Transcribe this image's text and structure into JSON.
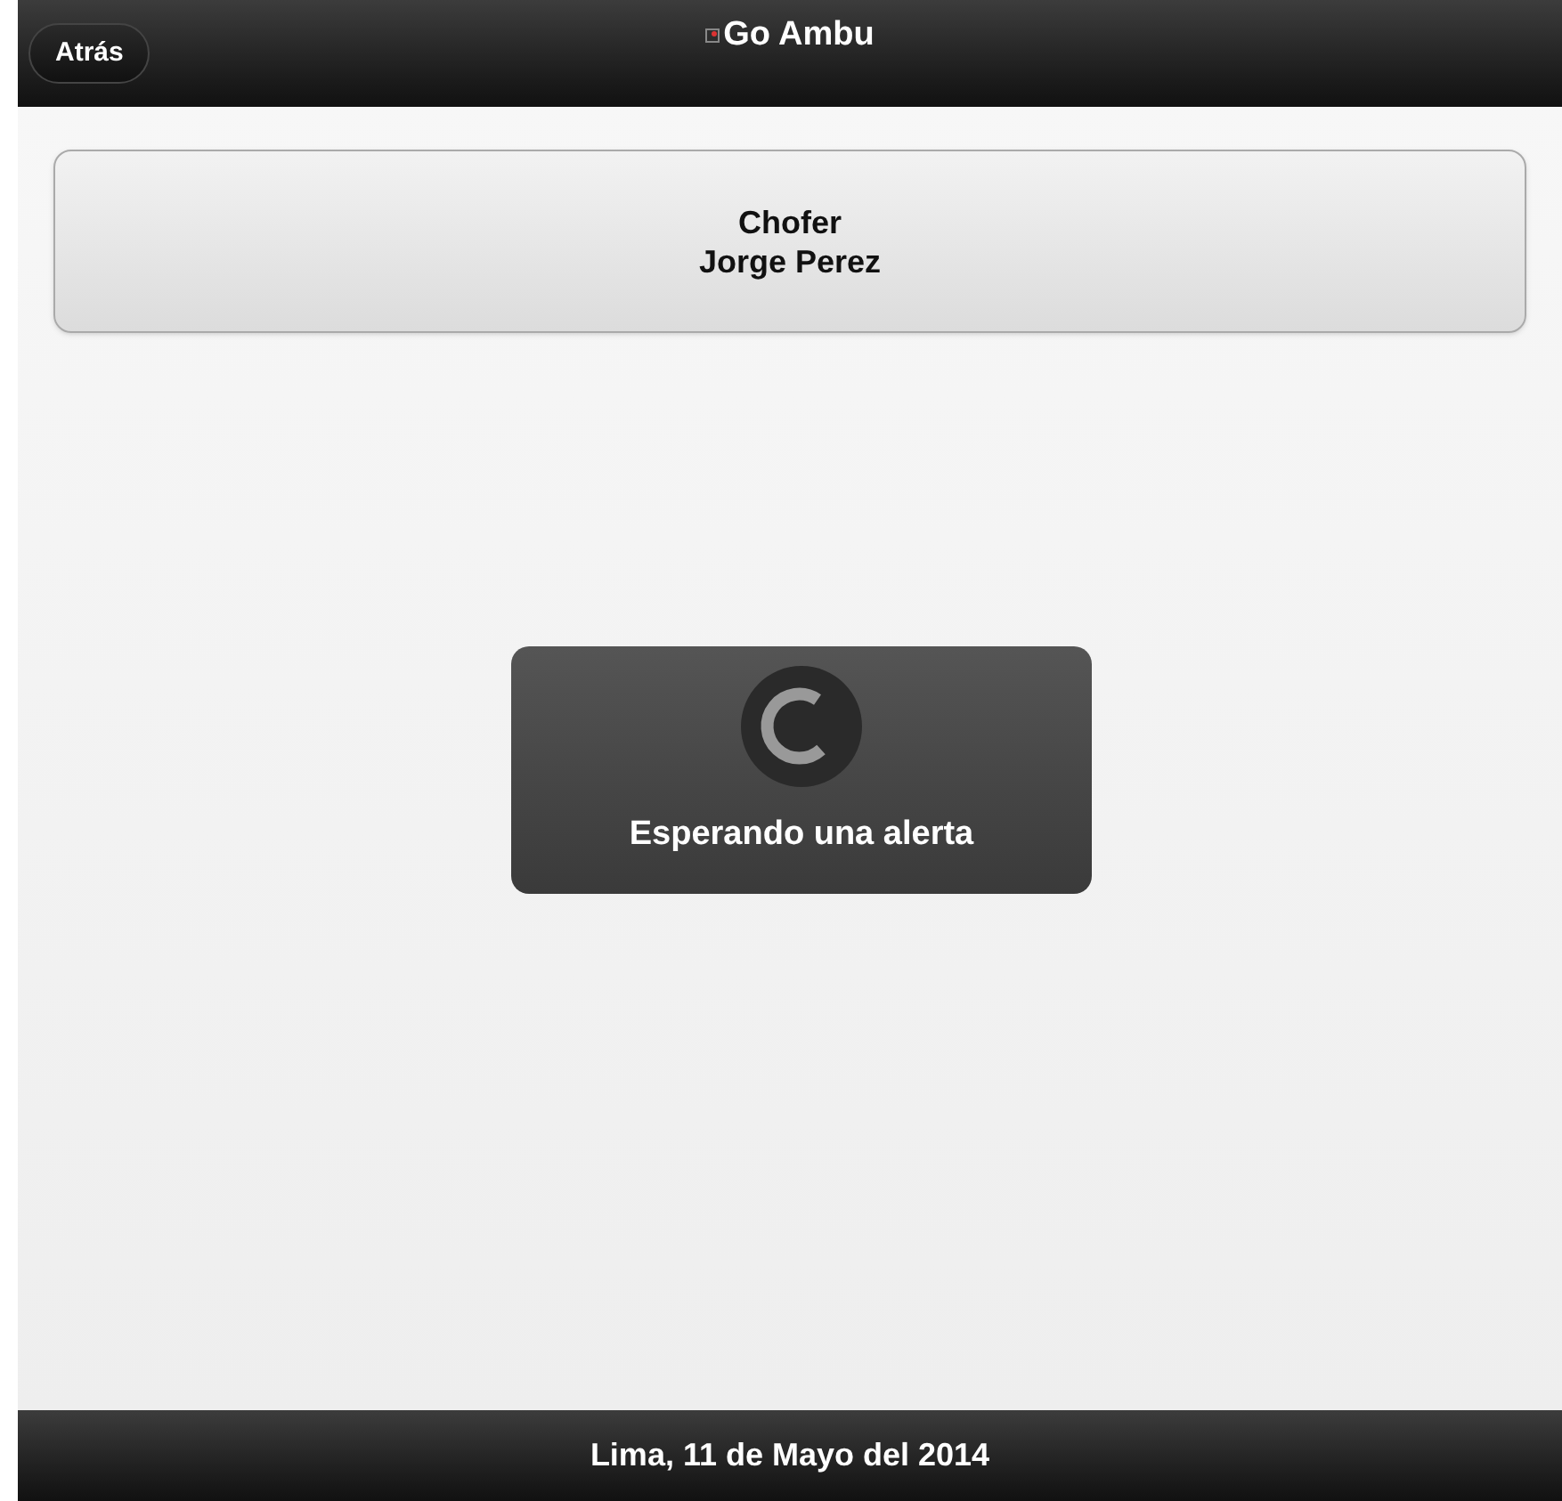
{
  "header": {
    "back_button": "Atrás",
    "title": "Go Ambu"
  },
  "driver_card": {
    "role": "Chofer",
    "name": "Jorge Perez"
  },
  "loader": {
    "message": "Esperando una alerta"
  },
  "footer": {
    "text": "Lima, 11 de Mayo del 2014"
  }
}
